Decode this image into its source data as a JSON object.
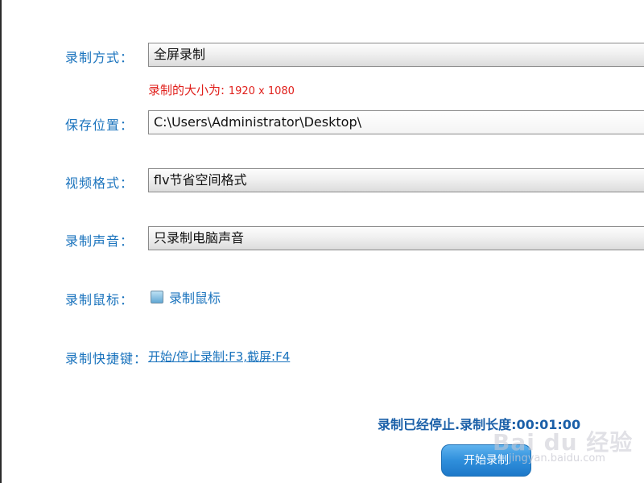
{
  "form": {
    "record_mode": {
      "label": "录制方式：",
      "value": "全屏录制"
    },
    "size_info": {
      "prefix": "录制的大小为: ",
      "value": "1920 x 1080"
    },
    "save_location": {
      "label": "保存位置：",
      "value": "C:\\Users\\Administrator\\Desktop\\"
    },
    "video_format": {
      "label": "视频格式：",
      "value": "flv节省空间格式"
    },
    "record_audio": {
      "label": "录制声音：",
      "value": "只录制电脑声音"
    },
    "record_mouse": {
      "label": "录制鼠标：",
      "checkbox_label": "录制鼠标",
      "checked": false
    },
    "hotkeys": {
      "label": "录制快捷键：",
      "link": "开始/停止录制:F3,截屏:F4"
    }
  },
  "status": {
    "text": "录制已经停止.录制长度:00:01:00"
  },
  "actions": {
    "start_label": "开始录制"
  },
  "watermark": {
    "logo": "Bai du 经验",
    "url": "jingyan.baidu.com"
  },
  "colors": {
    "label_blue": "#1a73bd",
    "size_red": "#e0201c",
    "status_blue": "#1a5fa8",
    "button_blue": "#2f8fdc"
  }
}
